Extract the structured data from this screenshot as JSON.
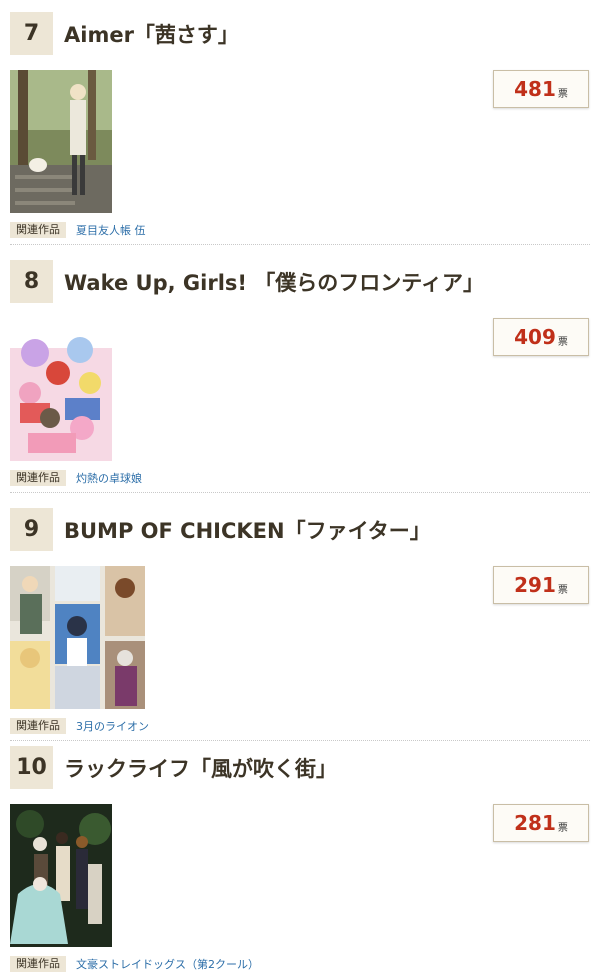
{
  "entries": [
    {
      "rank": "7",
      "title": "Aimer「茜さす」",
      "votes": "481",
      "vote_unit": "票",
      "related_label": "関連作品",
      "related_work": "夏目友人帳 伍"
    },
    {
      "rank": "8",
      "title": "Wake Up, Girls! 「僕らのフロンティア」",
      "votes": "409",
      "vote_unit": "票",
      "related_label": "関連作品",
      "related_work": "灼熱の卓球娘"
    },
    {
      "rank": "9",
      "title": "BUMP OF CHICKEN「ファイター」",
      "votes": "291",
      "vote_unit": "票",
      "related_label": "関連作品",
      "related_work": "3月のライオン"
    },
    {
      "rank": "10",
      "title": "ラックライフ「風が吹く街」",
      "votes": "281",
      "vote_unit": "票",
      "related_label": "関連作品",
      "related_work": "文豪ストレイドッグス（第2クール）"
    }
  ],
  "colors": {
    "rank_bg": "#ede6d6",
    "vote_number": "#c0301a",
    "link": "#2c6ea8",
    "vote_border": "#c9bea6"
  }
}
